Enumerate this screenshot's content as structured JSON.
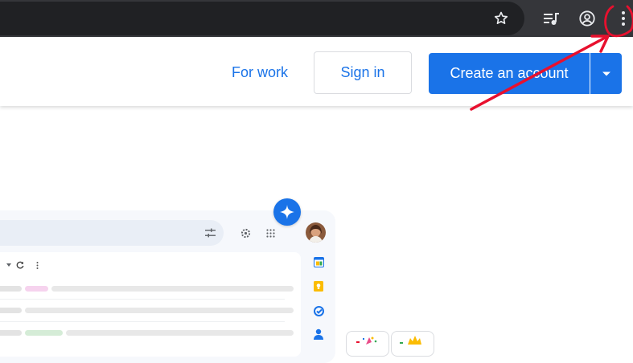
{
  "browser": {
    "toolbar_icons": [
      "star-icon",
      "media-control-icon",
      "profile-icon",
      "kebab-menu-icon"
    ]
  },
  "header": {
    "for_work": "For work",
    "sign_in": "Sign in",
    "create_account": "Create an account"
  },
  "preview": {
    "icons": [
      "filter-icon",
      "settings-icon",
      "apps-grid-icon",
      "refresh-icon",
      "more-vert-icon",
      "sparkle-icon"
    ],
    "side_apps": [
      "calendar-icon",
      "keep-icon",
      "tasks-icon",
      "contacts-icon"
    ]
  },
  "colors": {
    "chrome_bar": "#35363a",
    "omnibox": "#202124",
    "accent_blue": "#1a73e8",
    "annotation_red": "#e8102e"
  }
}
